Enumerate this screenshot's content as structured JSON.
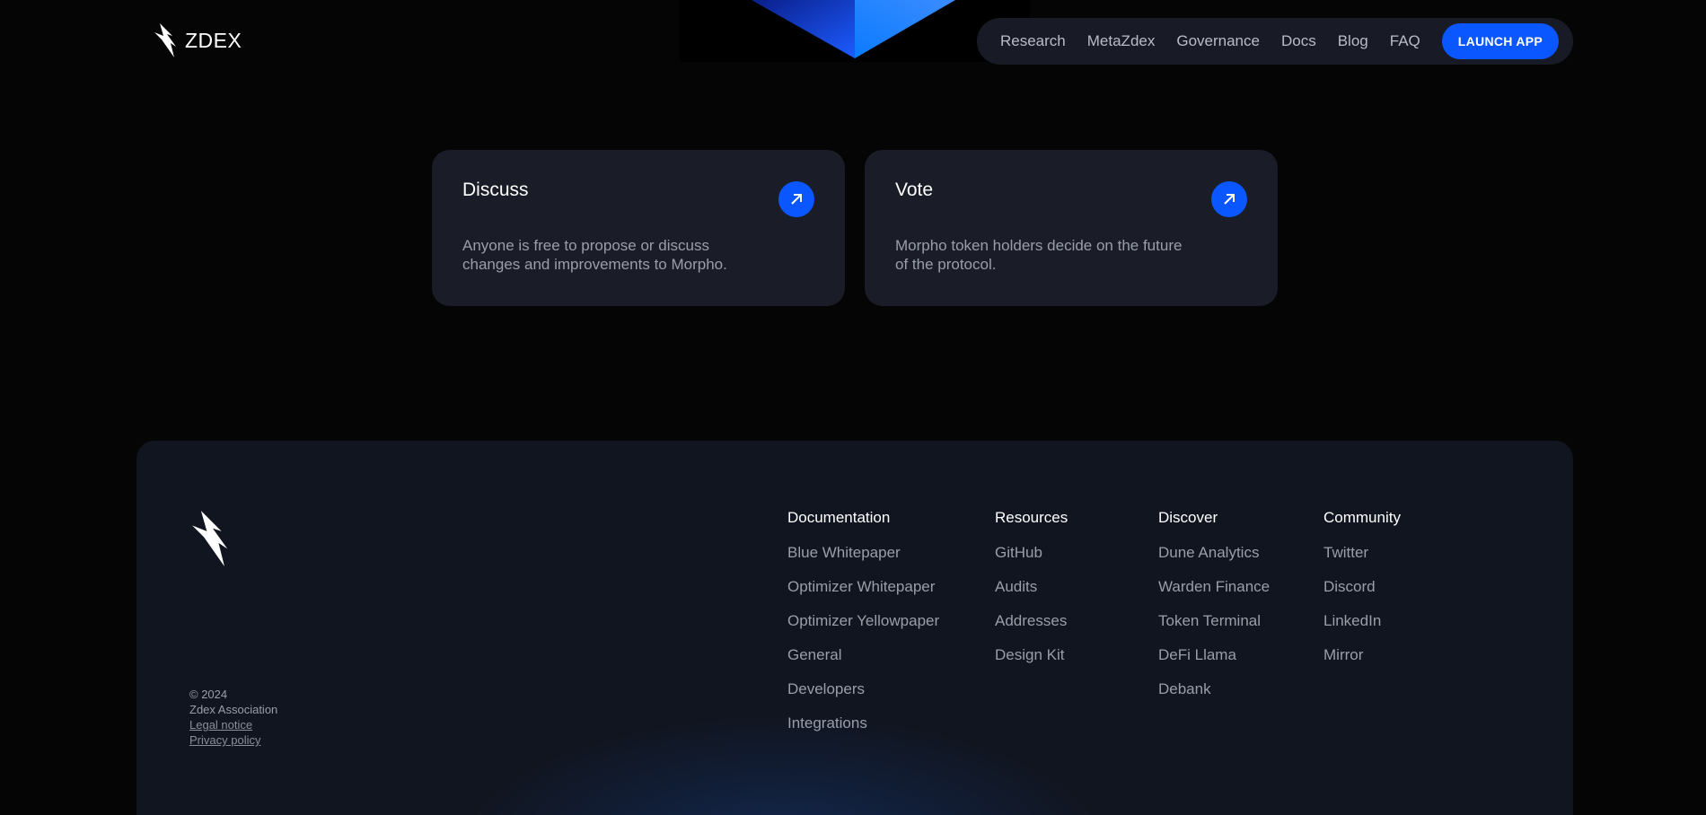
{
  "header": {
    "logo_text": "ZDEX",
    "nav": [
      "Research",
      "MetaZdex",
      "Governance",
      "Docs",
      "Blog",
      "FAQ"
    ],
    "cta": "LAUNCH APP"
  },
  "cards": [
    {
      "title": "Discuss",
      "description": "Anyone is free to propose or discuss changes and improvements to Morpho.",
      "icon": "arrow-up-right-icon"
    },
    {
      "title": "Vote",
      "description": "Morpho token holders decide on the future of the protocol.",
      "icon": "arrow-up-right-icon"
    }
  ],
  "footer": {
    "copyright": "© 2024",
    "org": "Zdex Association",
    "legal": "Legal notice",
    "privacy": "Privacy policy",
    "columns": [
      {
        "title": "Documentation",
        "links": [
          "Blue Whitepaper",
          "Optimizer Whitepaper",
          "Optimizer Yellowpaper",
          "General",
          "Developers",
          "Integrations"
        ]
      },
      {
        "title": "Resources",
        "links": [
          "GitHub",
          "Audits",
          "Addresses",
          "Design Kit"
        ]
      },
      {
        "title": "Discover",
        "links": [
          "Dune Analytics",
          "Warden Finance",
          "Token Terminal",
          "DeFi Llama",
          "Debank"
        ]
      },
      {
        "title": "Community",
        "links": [
          "Twitter",
          "Discord",
          "LinkedIn",
          "Mirror"
        ]
      }
    ]
  },
  "colors": {
    "background": "#050505",
    "surface": "#1a1d27",
    "accent": "#0b57ff",
    "muted_text": "#9a9eaa"
  }
}
